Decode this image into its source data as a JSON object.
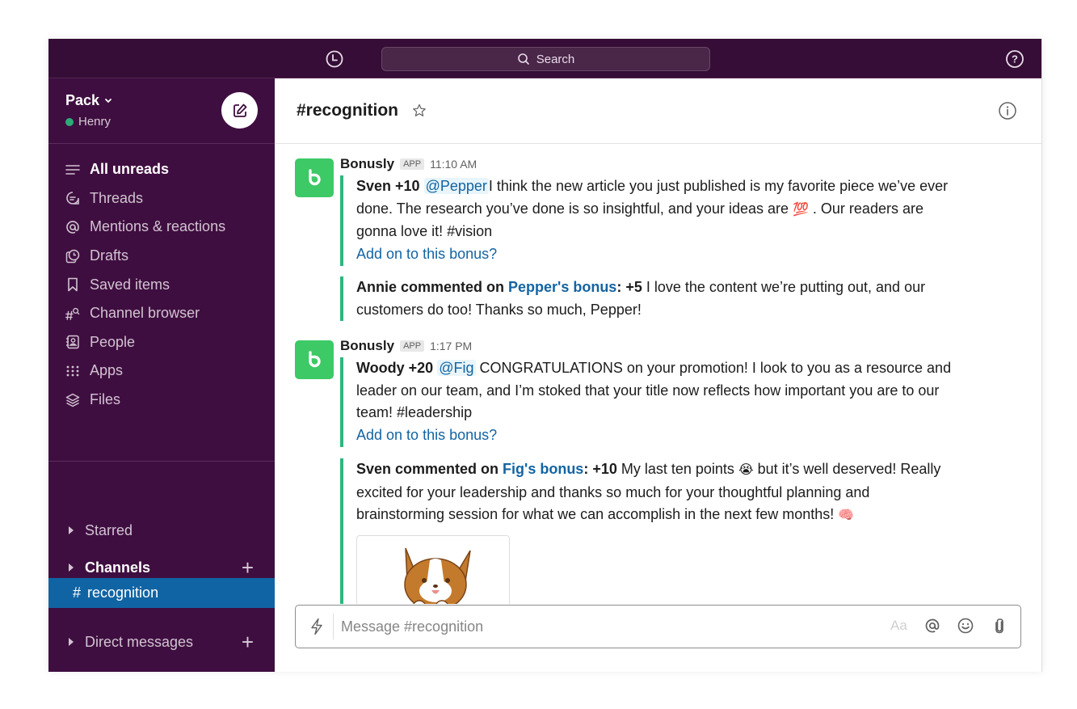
{
  "topbar": {
    "search_placeholder": "Search",
    "icons": {
      "history": "clock-icon",
      "search": "search-icon",
      "help": "help-circle-icon"
    }
  },
  "sidebar": {
    "workspace_name": "Pack",
    "user_name": "Henry",
    "user_status": "active",
    "nav_items": [
      {
        "label": "All unreads",
        "icon": "lines-icon",
        "bold": true
      },
      {
        "label": "Threads",
        "icon": "threads-icon"
      },
      {
        "label": "Mentions & reactions",
        "icon": "at-icon"
      },
      {
        "label": "Drafts",
        "icon": "drafts-icon"
      },
      {
        "label": "Saved items",
        "icon": "bookmark-icon"
      },
      {
        "label": "Channel browser",
        "icon": "channel-browser-icon"
      },
      {
        "label": "People",
        "icon": "people-icon"
      },
      {
        "label": "Apps",
        "icon": "apps-grid-icon"
      },
      {
        "label": "Files",
        "icon": "layers-icon"
      }
    ],
    "sections": {
      "starred": "Starred",
      "channels": "Channels",
      "direct_messages": "Direct messages"
    },
    "active_channel": {
      "prefix": "#",
      "name": "recognition"
    }
  },
  "channel": {
    "title": "#recognition",
    "composer_placeholder": "Message #recognition",
    "format_label": "Aa"
  },
  "messages": [
    {
      "sender": "Bonusly",
      "badge": "APP",
      "time": "11:10 AM",
      "bonus": {
        "giver": "Sven +10",
        "mention": "@Pepper",
        "text_1": "I think the new article you just published is my favorite piece we’ve ever done. The research you’ve done is so insightful, and your ideas are ",
        "emoji": "💯",
        "text_2": " . Our readers are gonna love it! #vision",
        "add_on": "Add on to this bonus?"
      },
      "comment": {
        "prefix": "Annie commented on ",
        "link": "Pepper's bonus",
        "points": ": +5",
        "text": " I love the content we’re putting out, and our customers do too! Thanks so much, Pepper!"
      }
    },
    {
      "sender": "Bonusly",
      "badge": "APP",
      "time": "1:17 PM",
      "bonus": {
        "giver": "Woody +20",
        "mention": "@Fig",
        "text_1": " CONGRATULATIONS on your promotion! I look to you as a resource and leader on our team, and I’m stoked that your title now reflects how important you are to our team! #leadership",
        "add_on": "Add on to this bonus?"
      },
      "comment": {
        "prefix": "Sven commented on ",
        "link": "Fig's bonus",
        "points": ": +10",
        "text_1": " My last ten points ",
        "emoji_1": "😭",
        "text_2": " but it’s well deserved! Really excited for your leadership and thanks so much for your thoughtful planning and brainstorming session for what we can accomplish in the next few months! ",
        "emoji_2": "🧠"
      }
    }
  ],
  "colors": {
    "topbar": "#350d36",
    "sidebar": "#3f0e40",
    "active_channel": "#1164a3",
    "bonusly_green": "#3dc966",
    "attachment_bar": "#2eb67d",
    "link": "#1264a3"
  }
}
